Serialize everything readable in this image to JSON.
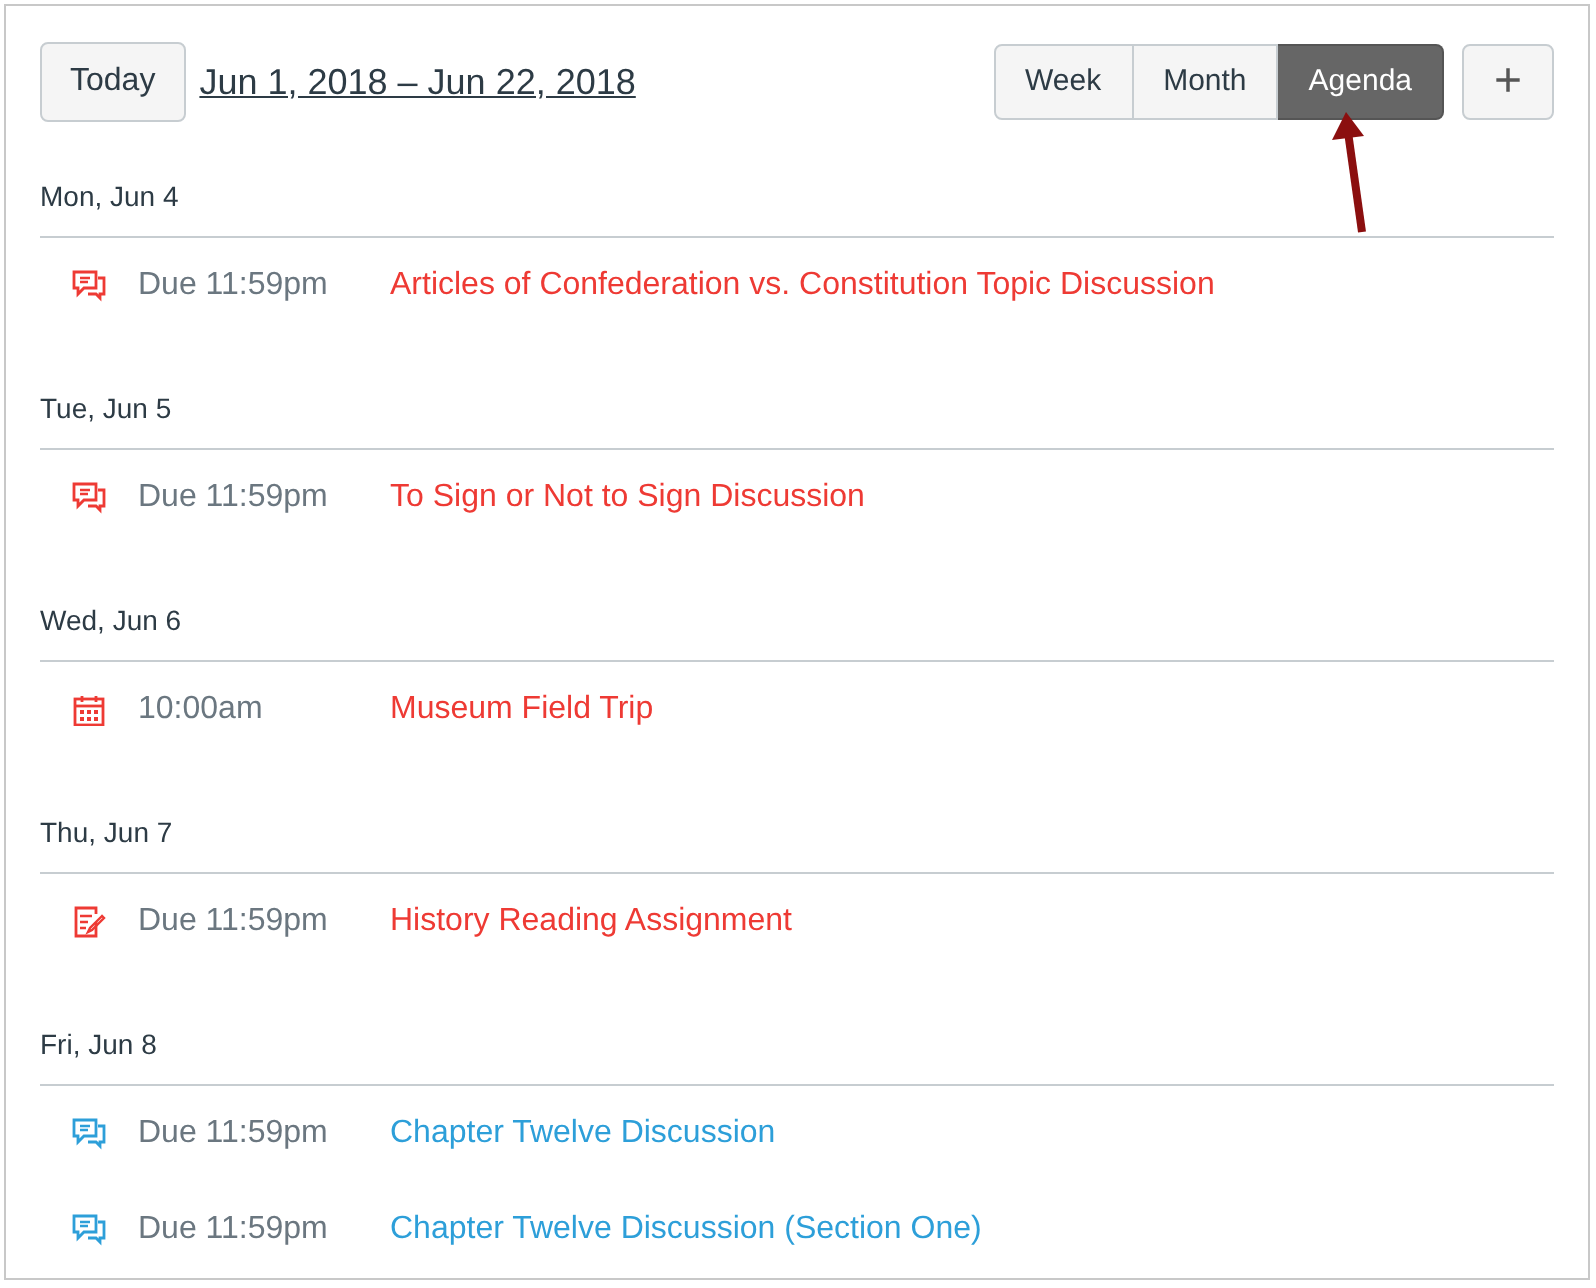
{
  "toolbar": {
    "today_button": "Today",
    "date_range": "Jun 1, 2018 – Jun 22, 2018",
    "views": [
      {
        "label": "Week",
        "selected": false
      },
      {
        "label": "Month",
        "selected": false
      },
      {
        "label": "Agenda",
        "selected": true
      }
    ],
    "add_button": "+"
  },
  "days": [
    {
      "date": "Mon, Jun 4",
      "events": [
        {
          "kind": "discussion",
          "time": "Due 11:59pm",
          "title": "Articles of Confederation vs. Constitution Topic Discussion",
          "color": "#ee3a34"
        }
      ]
    },
    {
      "date": "Tue, Jun 5",
      "events": [
        {
          "kind": "discussion",
          "time": "Due 11:59pm",
          "title": "To Sign or Not to Sign Discussion",
          "color": "#ee3a34"
        }
      ]
    },
    {
      "date": "Wed, Jun 6",
      "events": [
        {
          "kind": "calendar",
          "time": "10:00am",
          "title": "Museum Field Trip",
          "color": "#ee3a34"
        }
      ]
    },
    {
      "date": "Thu, Jun 7",
      "events": [
        {
          "kind": "assignment",
          "time": "Due 11:59pm",
          "title": "History Reading Assignment",
          "color": "#ee3a34"
        }
      ]
    },
    {
      "date": "Fri, Jun 8",
      "events": [
        {
          "kind": "discussion",
          "time": "Due 11:59pm",
          "title": "Chapter Twelve Discussion",
          "color": "#2d9fd9"
        },
        {
          "kind": "discussion",
          "time": "Due 11:59pm",
          "title": "Chapter Twelve Discussion (Section One)",
          "color": "#2d9fd9"
        }
      ]
    }
  ]
}
